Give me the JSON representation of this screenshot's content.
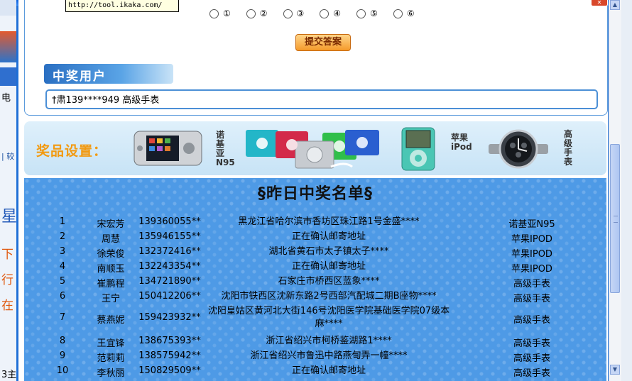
{
  "tooltip_url": "http://tool.ikaka.com/",
  "options": [
    "①",
    "②",
    "③",
    "④",
    "⑤",
    "⑥"
  ],
  "submit_label": "提交答案",
  "winners_heading": "中奖用户",
  "winner_ticker": "†肃139****949 高级手表",
  "prize_label": "奖品设置：",
  "prizes": [
    {
      "label": "诺基亚N95",
      "icon": "nokia-n95-phone"
    },
    {
      "label": "",
      "icon": "ipod-shuffle-group"
    },
    {
      "label": "苹果iPod",
      "icon": "ipod-nano"
    },
    {
      "label": "高级手表",
      "icon": "wrist-watch"
    }
  ],
  "list_title": "§昨日中奖名单§",
  "winners": [
    {
      "no": "1",
      "name": "宋宏芳",
      "phone": "139360055**",
      "addr": "黑龙江省哈尔滨市香坊区珠江路1号金盛****",
      "prize": "诺基亚N95"
    },
    {
      "no": "2",
      "name": "周慧",
      "phone": "135946155**",
      "addr": "正在确认邮寄地址",
      "prize": "苹果IPOD"
    },
    {
      "no": "3",
      "name": "徐荣俊",
      "phone": "132372416**",
      "addr": "湖北省黄石市太子镇太子****",
      "prize": "苹果IPOD"
    },
    {
      "no": "4",
      "name": "南顺玉",
      "phone": "132243354**",
      "addr": "正在确认邮寄地址",
      "prize": "苹果IPOD"
    },
    {
      "no": "5",
      "name": "崔鹏程",
      "phone": "134721890**",
      "addr": "石家庄市桥西区蓝象****",
      "prize": "高级手表"
    },
    {
      "no": "6",
      "name": "王宁",
      "phone": "150412206**",
      "addr": "沈阳市铁西区沈新东路2号西部汽配城二期B座物****",
      "prize": "高级手表"
    },
    {
      "no": "7",
      "name": "蔡燕妮",
      "phone": "159423932**",
      "addr": "沈阳皇姑区黄河北大街146号沈阳医学院基础医学院07级本麻****",
      "prize": "高级手表"
    },
    {
      "no": "8",
      "name": "王宜锋",
      "phone": "138675393**",
      "addr": "浙江省绍兴市柯桥鉴湖路1****",
      "prize": "高级手表"
    },
    {
      "no": "9",
      "name": "范莉莉",
      "phone": "138575942**",
      "addr": "浙江省绍兴市鲁迅中路燕甸弄一幢****",
      "prize": "高级手表"
    },
    {
      "no": "10",
      "name": "李秋丽",
      "phone": "150829509**",
      "addr": "正在确认邮寄地址",
      "prize": "高级手表"
    }
  ],
  "background_fragments": [
    "电",
    "下",
    "行",
    "在",
    "星",
    "3主",
    "| 较"
  ]
}
